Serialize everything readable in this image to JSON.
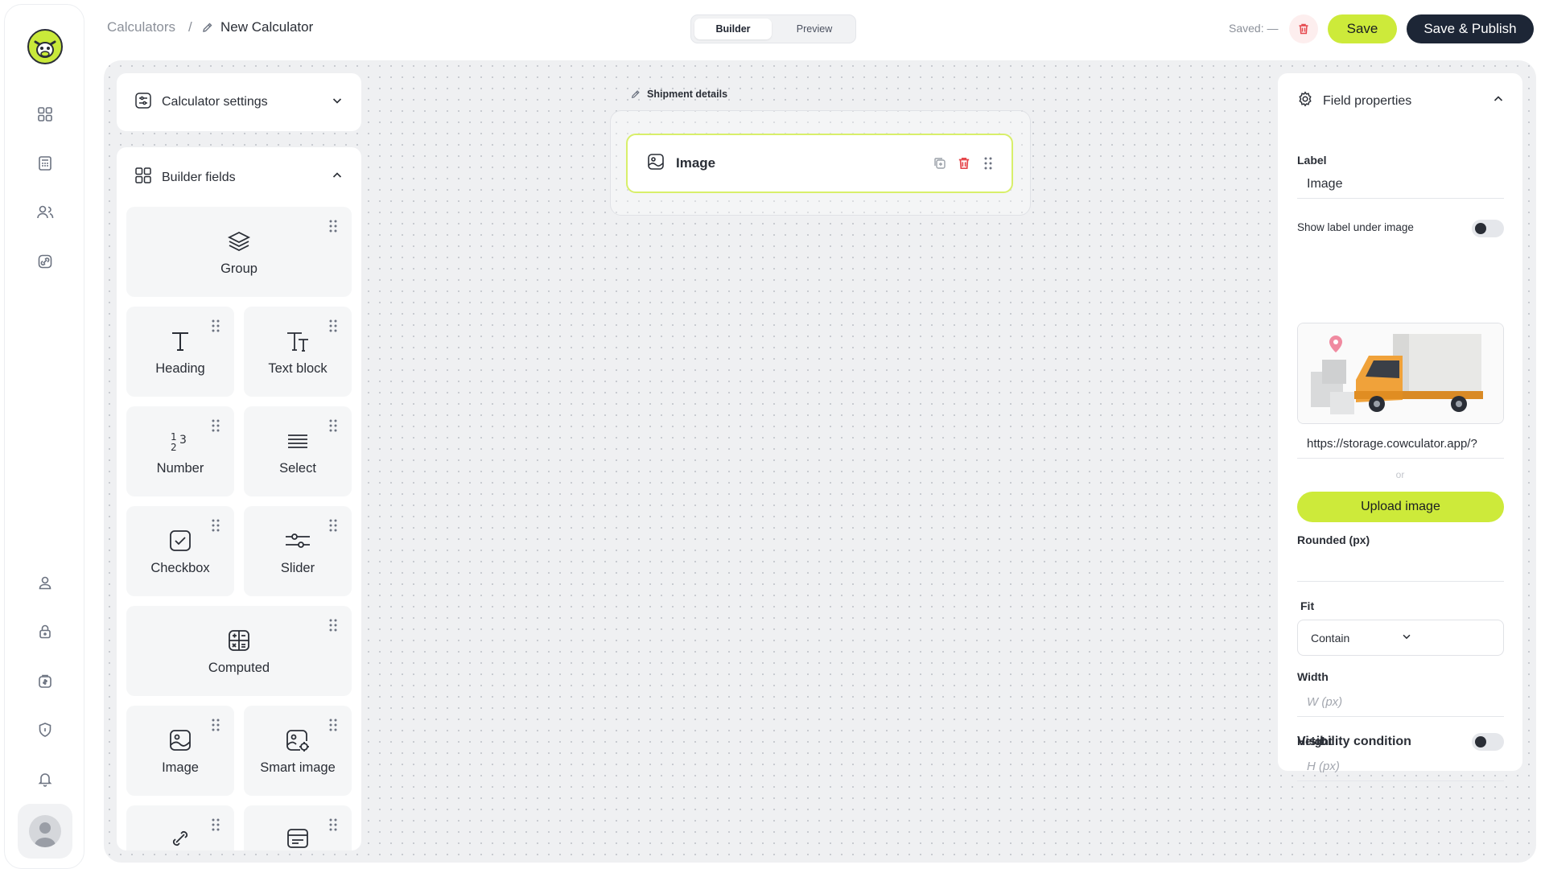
{
  "breadcrumb": {
    "root": "Calculators",
    "separator": "/",
    "current": "New Calculator"
  },
  "mode_tabs": [
    {
      "label": "Builder",
      "active": true
    },
    {
      "label": "Preview",
      "active": false
    }
  ],
  "header": {
    "saved_text": "Saved: —",
    "save_label": "Save",
    "publish_label": "Save & Publish"
  },
  "sidebar": {
    "top_icons": [
      "dashboard-icon",
      "calculator-icon",
      "users-icon",
      "link-icon"
    ],
    "bottom_icons": [
      "user-icon",
      "lock-icon",
      "billing-icon",
      "shield-icon",
      "bell-icon"
    ]
  },
  "left_panel": {
    "settings_title": "Calculator settings",
    "fields_title": "Builder fields",
    "fields": [
      {
        "label": "Group",
        "icon": "layers-icon"
      },
      {
        "label": "Heading",
        "icon": "heading-icon"
      },
      {
        "label": "Text block",
        "icon": "text-block-icon"
      },
      {
        "label": "Number",
        "icon": "number-icon"
      },
      {
        "label": "Select",
        "icon": "select-icon"
      },
      {
        "label": "Checkbox",
        "icon": "checkbox-icon"
      },
      {
        "label": "Slider",
        "icon": "slider-icon"
      },
      {
        "label": "Computed",
        "icon": "computed-icon"
      },
      {
        "label": "Image",
        "icon": "image-icon"
      },
      {
        "label": "Smart image",
        "icon": "smart-image-icon"
      }
    ]
  },
  "canvas": {
    "group_title": "Shipment details",
    "field_label": "Image"
  },
  "properties": {
    "title": "Field properties",
    "label_title": "Label",
    "label_value": "Image",
    "show_label_text": "Show label under image",
    "image_url": "https://storage.cowculator.app/?",
    "or_text": "or",
    "upload_label": "Upload image",
    "rounded_title": "Rounded (px)",
    "fit_title": "Fit",
    "fit_value": "Contain",
    "width_title": "Width",
    "width_placeholder": "W (px)",
    "height_title": "Height",
    "height_placeholder": "H (px)",
    "visibility_title": "Visibility condition"
  },
  "colors": {
    "accent": "#cdea3a",
    "dark": "#1d2636",
    "danger": "#e5484d"
  }
}
